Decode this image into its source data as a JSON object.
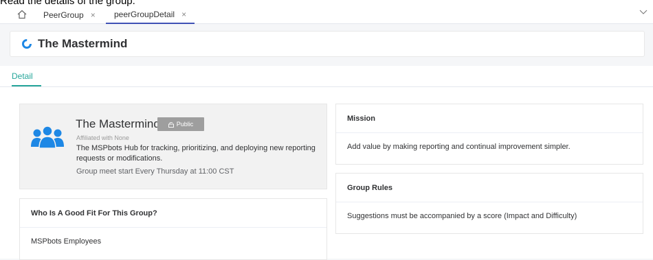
{
  "instruction": "Read the details of the group.",
  "tabs": [
    {
      "label": "PeerGroup",
      "close": "×"
    },
    {
      "label": "peerGroupDetail",
      "close": "×"
    }
  ],
  "page": {
    "title": "The Mastermind",
    "detail_tab": "Detail"
  },
  "group": {
    "name": "The Mastermind",
    "badge": "Public",
    "affiliated": "Affiliated with None",
    "description": "The MSPbots Hub for tracking, prioritizing, and deploying new reporting requests or modifications.",
    "meeting": "Group meet start Every Thursday at 11:00 CST"
  },
  "good_fit": {
    "title": "Who Is A Good Fit For This Group?",
    "value": "MSPbots Employees"
  },
  "mission": {
    "title": "Mission",
    "value": "Add value by making reporting and continual improvement simpler."
  },
  "rules": {
    "title": "Group Rules",
    "value": "Suggestions must be accompanied by a score (Impact and Difficulty)"
  },
  "colors": {
    "accent": "#26a69a",
    "active_tab_border": "#3f51b5",
    "group_icon": "#1e88e5",
    "badge_bg": "#9e9e9e"
  }
}
